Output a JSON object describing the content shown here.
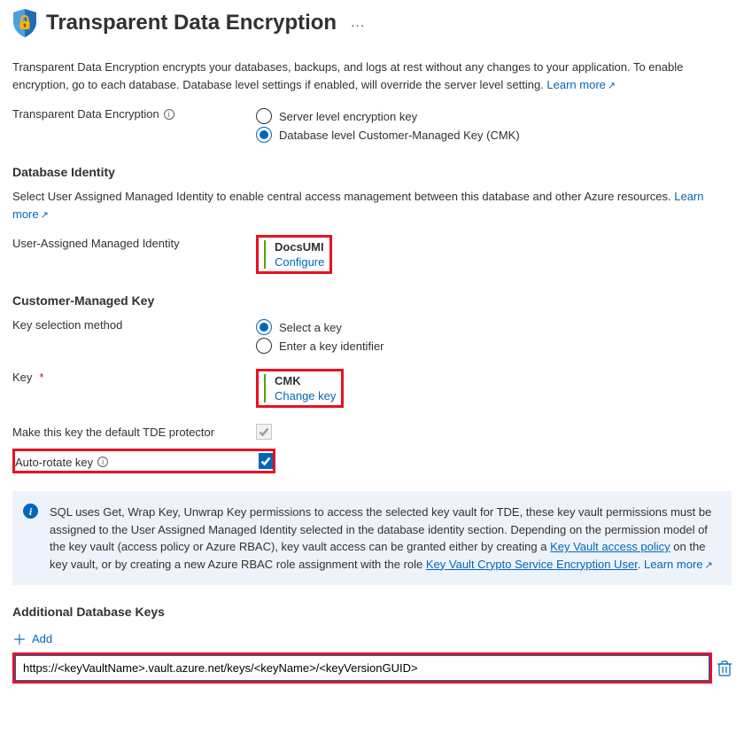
{
  "header": {
    "title": "Transparent Data Encryption",
    "more": "..."
  },
  "intro": {
    "text": "Transparent Data Encryption encrypts your databases, backups, and logs at rest without any changes to your application. To enable encryption, go to each database. Database level settings if enabled, will override the server level setting. ",
    "learn_more": "Learn more"
  },
  "tde": {
    "label": "Transparent Data Encryption",
    "opt1": "Server level encryption key",
    "opt2": "Database level Customer-Managed Key (CMK)"
  },
  "identity": {
    "heading": "Database Identity",
    "desc": "Select User Assigned Managed Identity to enable central access management between this database and other Azure resources. ",
    "learn_more": "Learn more",
    "label": "User-Assigned Managed Identity",
    "value_name": "DocsUMI",
    "value_action": "Configure"
  },
  "cmk": {
    "heading": "Customer-Managed Key",
    "sel_label": "Key selection method",
    "sel_opt1": "Select a key",
    "sel_opt2": "Enter a key identifier",
    "key_label": "Key",
    "key_name": "CMK",
    "key_action": "Change key",
    "default_label": "Make this key the default TDE protector",
    "autorotate_label": "Auto-rotate key"
  },
  "info_box": {
    "text1": "SQL uses Get, Wrap Key, Unwrap Key permissions to access the selected key vault for TDE, these key vault permissions must be assigned to the User Assigned Managed Identity selected in the database identity section. Depending on the permission model of the key vault (access policy or Azure RBAC), key vault access can be granted either by creating a ",
    "link1": "Key Vault access policy",
    "text2": " on the key vault, or by creating a new Azure RBAC role assignment with the role ",
    "link2": "Key Vault Crypto Service Encryption User",
    "text3": ". ",
    "learn_more": "Learn more"
  },
  "additional": {
    "heading": "Additional Database Keys",
    "add_label": "Add",
    "input_value": "https://<keyVaultName>.vault.azure.net/keys/<keyName>/<keyVersionGUID>"
  }
}
